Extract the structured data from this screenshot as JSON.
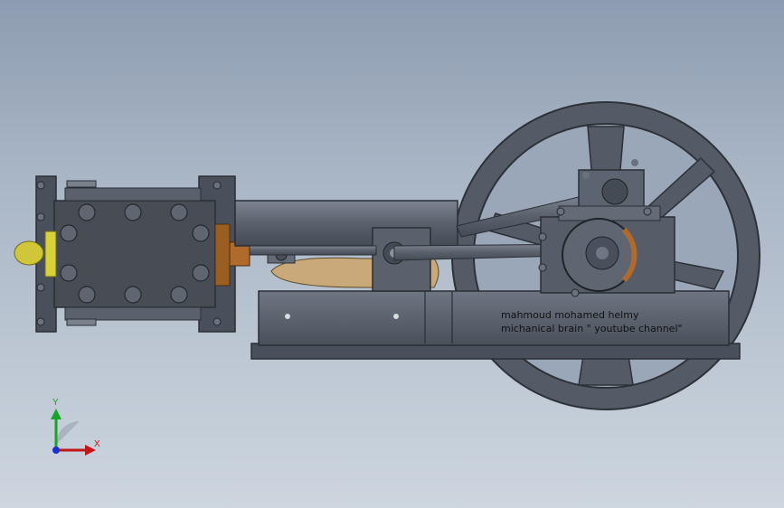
{
  "model": {
    "engraving_line1": "mahmoud mohamed helmy",
    "engraving_line2": "michanical brain \" youtube channel\""
  },
  "triad": {
    "y_label": "Y",
    "x_label": "X",
    "y_color": "#18a32a",
    "x_color": "#c01818",
    "z_color": "#1a2fd0"
  },
  "colors": {
    "metal": "#5d6471",
    "metal_dark": "#3d434d",
    "copper": "#b06a2c",
    "brass": "#c9b57a",
    "bolt_yellow": "#d8d23a"
  }
}
